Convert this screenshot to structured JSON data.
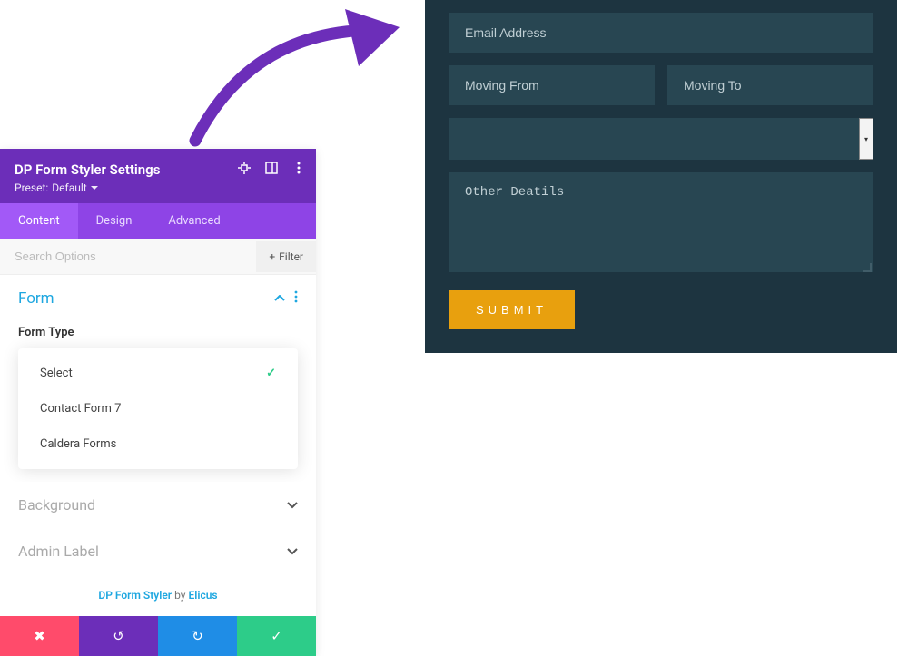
{
  "panel": {
    "title": "DP Form Styler Settings",
    "preset_label": "Preset:",
    "preset_value": "Default"
  },
  "tabs": {
    "content": "Content",
    "design": "Design",
    "advanced": "Advanced"
  },
  "search": {
    "placeholder": "Search Options",
    "filter_label": "Filter"
  },
  "sections": {
    "form": "Form",
    "form_type_label": "Form Type",
    "background": "Background",
    "admin_label": "Admin Label"
  },
  "form_type_options": {
    "select": "Select",
    "contact_form_7": "Contact Form 7",
    "caldera_forms": "Caldera Forms"
  },
  "credit": {
    "product": "DP Form Styler",
    "by": " by ",
    "author": "Elicus"
  },
  "preview": {
    "email_placeholder": "Email Address",
    "moving_from_placeholder": "Moving From",
    "moving_to_placeholder": "Moving To",
    "other_details_placeholder": "Other Deatils",
    "submit_label": "SUBMIT"
  },
  "colors": {
    "panel_header": "#6c2eb9",
    "tab_bg": "#8e44e6",
    "tab_active": "#a259f7",
    "accent_blue": "#1ea7e0",
    "preview_bg": "#1d3440",
    "preview_input": "#284652",
    "submit_btn": "#e8a00e"
  }
}
